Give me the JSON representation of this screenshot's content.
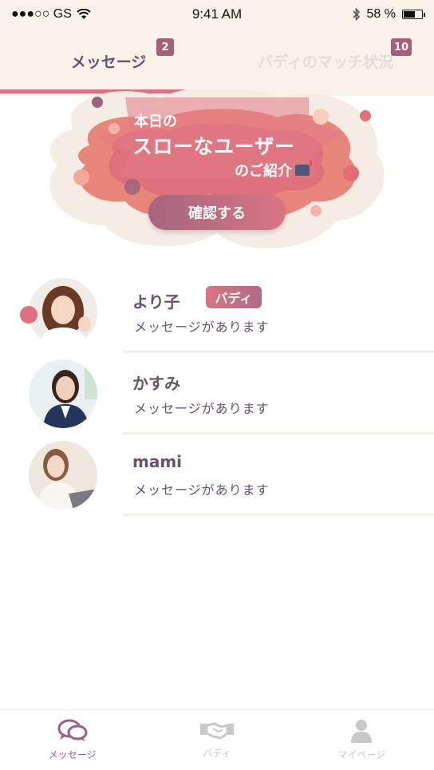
{
  "status_bar": {
    "carrier": "●●●○○ GS",
    "time": "9:41 AM",
    "battery": "58 %",
    "battery_level": 0.58
  },
  "tabs": [
    {
      "label": "メッセージ",
      "badge": "2",
      "active": true
    },
    {
      "label": "バディのマッチ状況",
      "badge": "10",
      "active": false
    }
  ],
  "banner": {
    "line1": "本日の",
    "line2": "スローなユーザー",
    "line3": "のご紹介",
    "button_label": "確認する"
  },
  "messages": [
    {
      "name": "より子",
      "badge": "バディ",
      "message": "メッセージがあります",
      "unread": true
    },
    {
      "name": "かすみ",
      "message": "メッセージがあります",
      "unread": false
    },
    {
      "name": "mami",
      "message": "メッセージがあります",
      "unread": false
    }
  ],
  "bottom_nav": [
    {
      "label": "メッセージ",
      "icon": "chat-bubbles-icon",
      "active": true
    },
    {
      "label": "バディ",
      "icon": "handshake-icon",
      "active": false
    },
    {
      "label": "マイページ",
      "icon": "person-icon",
      "active": false
    }
  ],
  "colors": {
    "accent": "#dd7180",
    "primary_text": "#6b5170",
    "header_bg": "#f8f2e9",
    "badge": "#a95e78"
  }
}
